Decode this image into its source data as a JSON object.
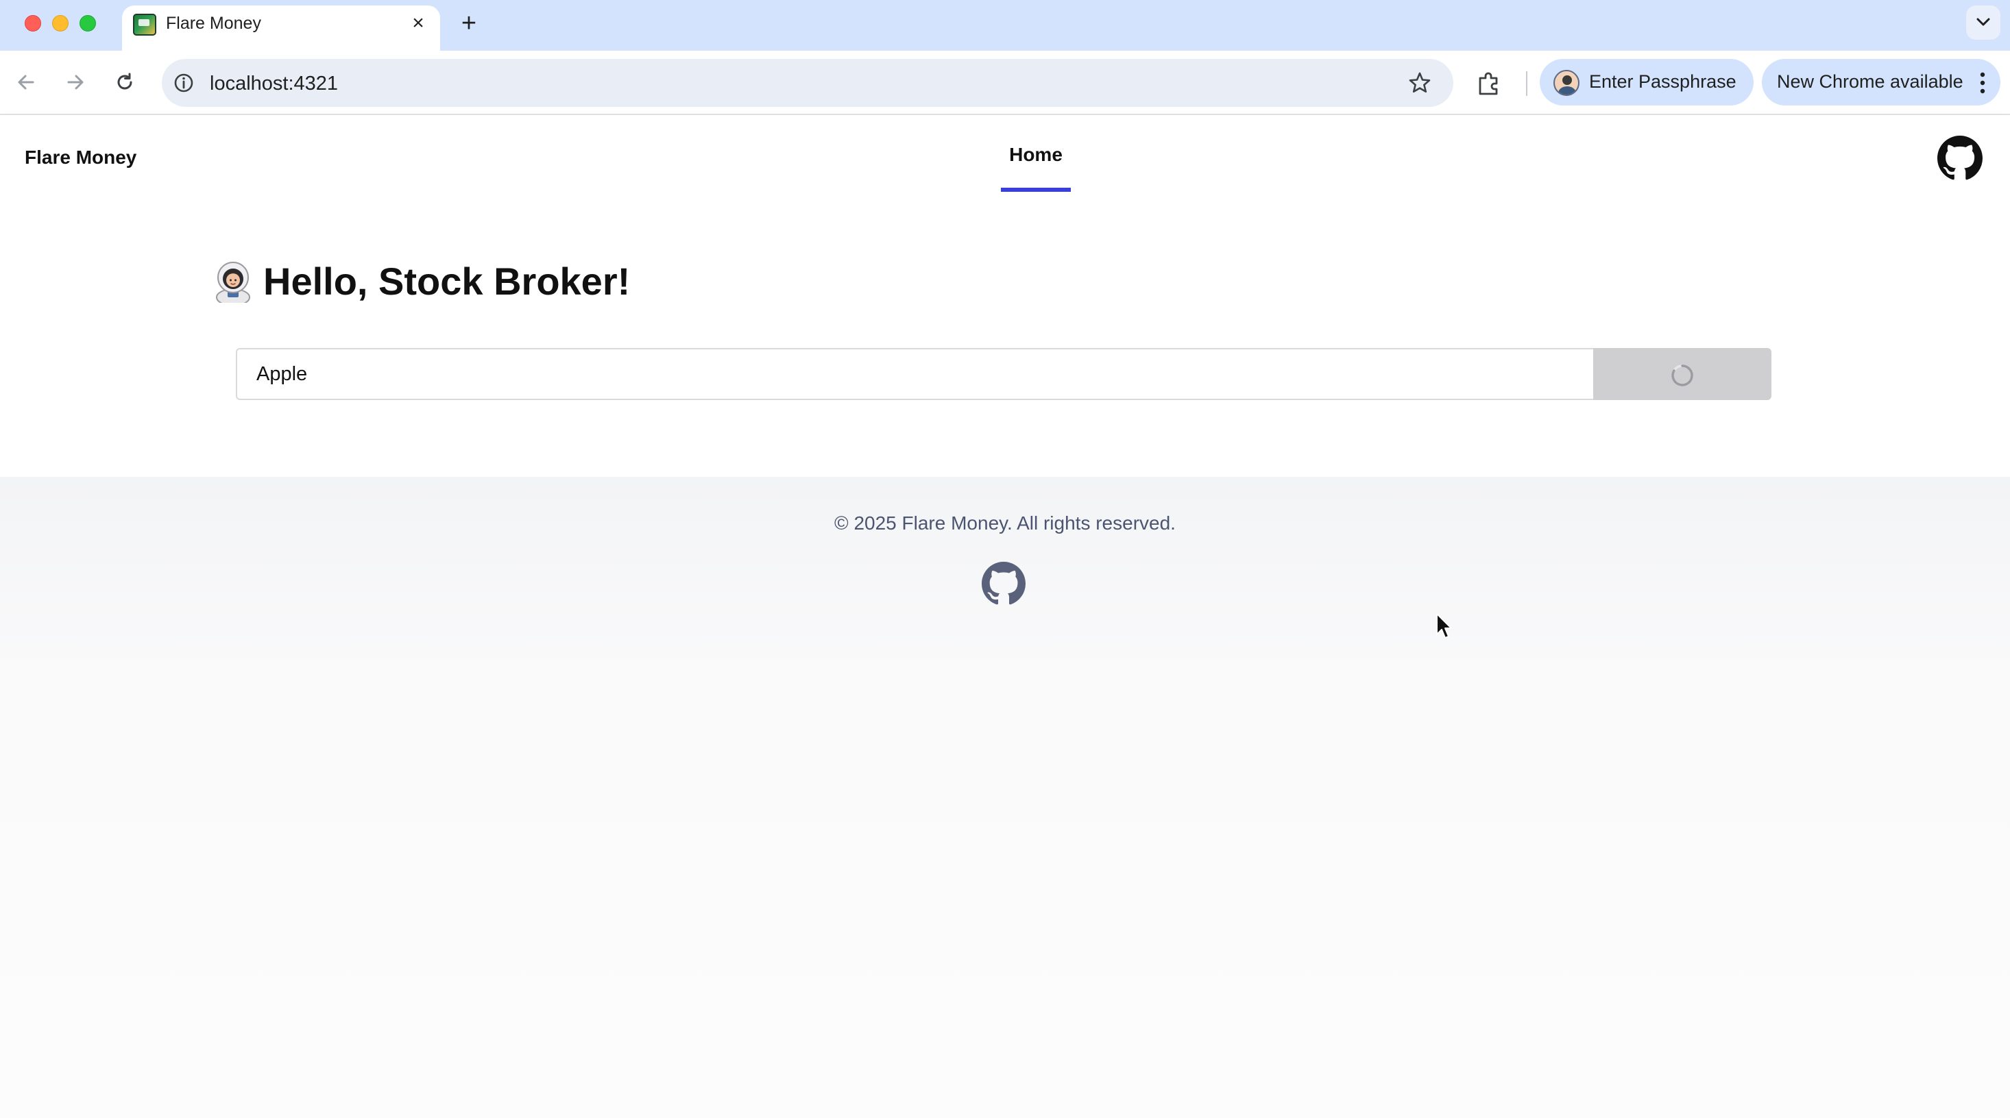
{
  "browser": {
    "tab_title": "Flare Money",
    "url": "localhost:4321",
    "profile_label": "Enter Passphrase",
    "update_label": "New Chrome available",
    "icons": {
      "tab_favicon": "flare-money-favicon",
      "tab_close": "close-icon",
      "new_tab": "plus-icon",
      "tab_list": "chevron-down-icon",
      "back": "arrow-left-icon",
      "forward": "arrow-right-icon",
      "reload": "reload-icon",
      "site_info": "info-icon",
      "bookmark": "star-icon",
      "extensions": "puzzle-icon",
      "menu": "kebab-menu-icon"
    }
  },
  "header": {
    "brand": "Flare Money",
    "nav": [
      {
        "label": "Home",
        "active": true
      }
    ],
    "github_icon": "github-icon",
    "accent_color": "#3b3fd9"
  },
  "main": {
    "greeting_emoji": "astronaut-emoji",
    "greeting": "Hello, Stock Broker!",
    "search": {
      "value": "Apple",
      "button_state": "loading"
    }
  },
  "footer": {
    "copyright": "© 2025 Flare Money. All rights reserved.",
    "github_icon": "github-icon",
    "text_color": "#4b5470"
  }
}
